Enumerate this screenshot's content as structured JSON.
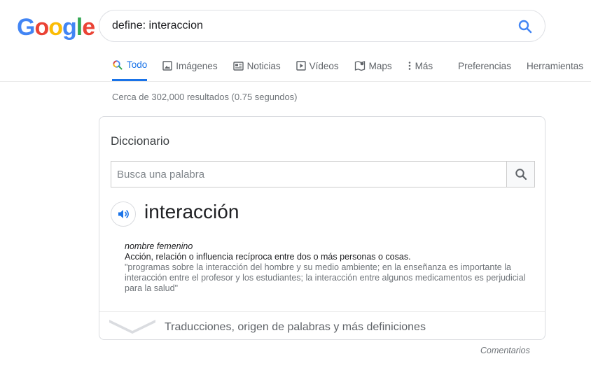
{
  "logo": {
    "letters": [
      "G",
      "o",
      "o",
      "g",
      "l",
      "e"
    ]
  },
  "search": {
    "query": "define: interaccion"
  },
  "tabs": [
    {
      "label": "Todo",
      "icon": "search-icon",
      "active": true
    },
    {
      "label": "Imágenes",
      "icon": "image-icon"
    },
    {
      "label": "Noticias",
      "icon": "news-icon"
    },
    {
      "label": "Vídeos",
      "icon": "video-icon"
    },
    {
      "label": "Maps",
      "icon": "map-icon"
    },
    {
      "label": "Más",
      "icon": "more-vert-icon"
    }
  ],
  "tools": {
    "preferences": "Preferencias",
    "tools": "Herramientas"
  },
  "result_stats": "Cerca de 302,000 resultados (0.75 segundos)",
  "dictionary": {
    "title": "Diccionario",
    "search_placeholder": "Busca una palabra",
    "headword": "interacción",
    "part_of_speech": "nombre femenino",
    "definition": "Acción, relación o influencia recíproca entre dos o más personas o cosas.",
    "example": "\"programas sobre la interacción del hombre y su medio ambiente; en la enseñanza es importante la interacción entre el profesor y los estudiantes; la interacción entre algunos medicamentos es perjudicial para la salud\"",
    "more_link": "Traducciones, origen de palabras y más definiciones"
  },
  "feedback": "Comentarios",
  "colors": {
    "accent": "#1a73e8",
    "muted": "#70757a",
    "border": "#dadce0"
  }
}
